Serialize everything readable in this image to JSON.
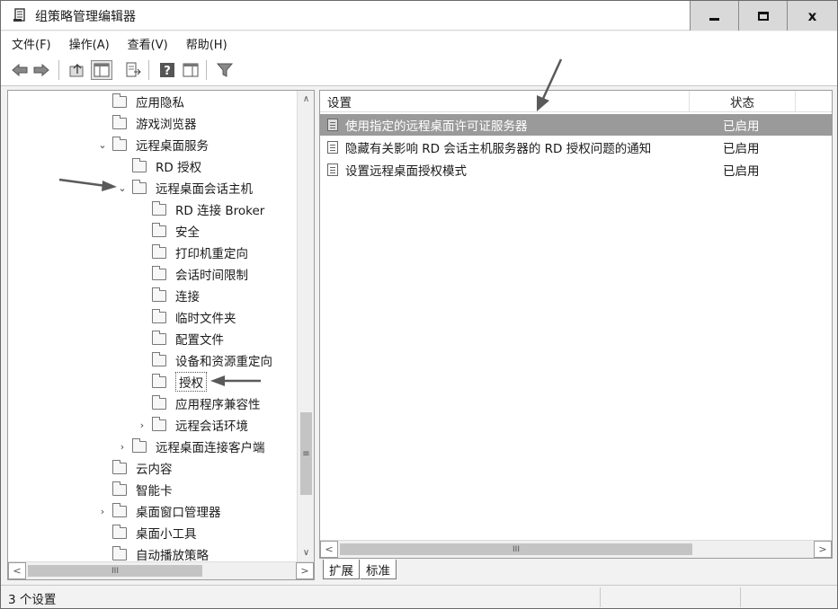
{
  "window": {
    "title": "组策略管理编辑器",
    "controls": {
      "minimize_icon": "minimize-icon",
      "maximize_icon": "maximize-icon",
      "close_label": "x"
    }
  },
  "menubar": {
    "items": [
      {
        "label": "文件(F)"
      },
      {
        "label": "操作(A)"
      },
      {
        "label": "查看(V)"
      },
      {
        "label": "帮助(H)"
      }
    ]
  },
  "toolbar": {
    "icons": [
      "back-icon",
      "forward-icon",
      "up-level-icon",
      "show-hide-tree-icon",
      "export-list-icon",
      "help-icon",
      "show-hide-action-pane-icon",
      "filter-icon"
    ]
  },
  "tree": {
    "nodes": [
      {
        "label": "应用隐私",
        "expander": ""
      },
      {
        "label": "游戏浏览器",
        "expander": ""
      },
      {
        "label": "远程桌面服务",
        "expander": "⌄"
      },
      {
        "label": "RD 授权",
        "expander": ""
      },
      {
        "label": "远程桌面会话主机",
        "expander": "⌄"
      },
      {
        "label": "RD 连接 Broker",
        "expander": ""
      },
      {
        "label": "安全",
        "expander": ""
      },
      {
        "label": "打印机重定向",
        "expander": ""
      },
      {
        "label": "会话时间限制",
        "expander": ""
      },
      {
        "label": "连接",
        "expander": ""
      },
      {
        "label": "临时文件夹",
        "expander": ""
      },
      {
        "label": "配置文件",
        "expander": ""
      },
      {
        "label": "设备和资源重定向",
        "expander": ""
      },
      {
        "label": "授权",
        "expander": ""
      },
      {
        "label": "应用程序兼容性",
        "expander": ""
      },
      {
        "label": "远程会话环境",
        "expander": "›"
      },
      {
        "label": "远程桌面连接客户端",
        "expander": "›"
      },
      {
        "label": "云内容",
        "expander": ""
      },
      {
        "label": "智能卡",
        "expander": ""
      },
      {
        "label": "桌面窗口管理器",
        "expander": "›"
      },
      {
        "label": "桌面小工具",
        "expander": ""
      },
      {
        "label": "自动播放策略",
        "expander": ""
      }
    ],
    "selected": "授权",
    "vscroll_grip": "≡",
    "hscroll_grip": "III",
    "arrow_up": "∧",
    "arrow_down": "∨",
    "arrow_left": "<",
    "arrow_right": ">"
  },
  "list": {
    "columns": {
      "setting": "设置",
      "state": "状态"
    },
    "rows": [
      {
        "label": "使用指定的远程桌面许可证服务器",
        "state": "已启用"
      },
      {
        "label": "隐藏有关影响 RD 会话主机服务器的 RD 授权问题的通知",
        "state": "已启用"
      },
      {
        "label": "设置远程桌面授权模式",
        "state": "已启用"
      }
    ],
    "hscroll_grip": "III",
    "arrow_left": "<",
    "arrow_right": ">"
  },
  "tabs": [
    {
      "label": "扩展"
    },
    {
      "label": "标准"
    }
  ],
  "statusbar": {
    "text": "3 个设置"
  },
  "colors": {
    "selection": "#9a9a9a",
    "annotation_arrow": "#5a5a5a"
  }
}
